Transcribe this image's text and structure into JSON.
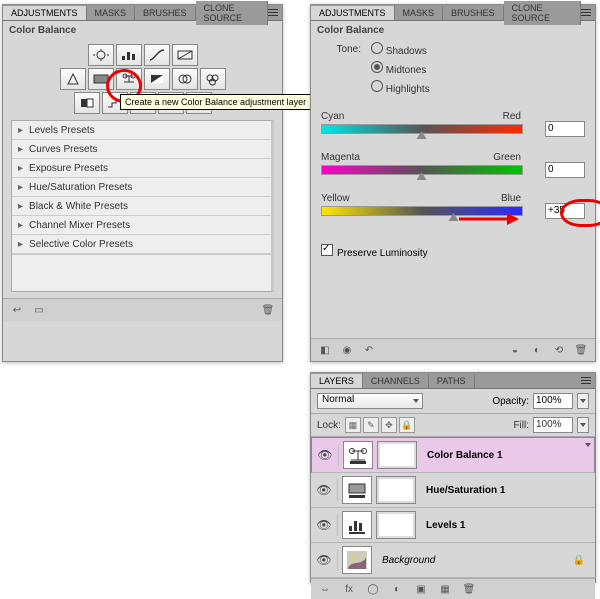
{
  "left": {
    "tabs": [
      "ADJUSTMENTS",
      "MASKS",
      "BRUSHES",
      "CLONE SOURCE"
    ],
    "title": "Color Balance",
    "tooltip": "Create a new Color Balance adjustment layer",
    "iconRows": [
      [
        "brightness-contrast-icon",
        "levels-icon",
        "curves-icon",
        "exposure-icon"
      ],
      [
        "vibrance-icon",
        "hue-saturation-icon",
        "color-balance-icon",
        "black-white-icon",
        "photo-filter-icon",
        "channel-mixer-icon"
      ],
      [
        "invert-icon",
        "posterize-icon",
        "threshold-icon",
        "gradient-map-icon",
        "selective-color-icon"
      ]
    ],
    "presets": [
      "Levels Presets",
      "Curves Presets",
      "Exposure Presets",
      "Hue/Saturation Presets",
      "Black & White Presets",
      "Channel Mixer Presets",
      "Selective Color Presets"
    ]
  },
  "right": {
    "tabs": [
      "ADJUSTMENTS",
      "MASKS",
      "BRUSHES",
      "CLONE SOURCE"
    ],
    "title": "Color Balance",
    "tone_label": "Tone:",
    "tone": [
      "Shadows",
      "Midtones",
      "Highlights"
    ],
    "tone_selected": 1,
    "sliders": [
      {
        "left": "Cyan",
        "right": "Red",
        "value": 0,
        "pos": 50,
        "grad": [
          "#00e5e5",
          "#555",
          "#ff2a00"
        ]
      },
      {
        "left": "Magenta",
        "right": "Green",
        "value": 0,
        "pos": 50,
        "grad": [
          "#ff00c8",
          "#555",
          "#00c400"
        ]
      },
      {
        "left": "Yellow",
        "right": "Blue",
        "value": "+35",
        "pos": 66,
        "grad": [
          "#ffe600",
          "#555",
          "#2a2aff"
        ]
      }
    ],
    "preserve": "Preserve Luminosity",
    "preserve_checked": true
  },
  "layers": {
    "tabs": [
      "LAYERS",
      "CHANNELS",
      "PATHS"
    ],
    "blend": "Normal",
    "opacity_label": "Opacity:",
    "opacity": "100%",
    "lock_label": "Lock:",
    "fill_label": "Fill:",
    "fill": "100%",
    "items": [
      {
        "name": "Color Balance 1",
        "kind": "color-balance",
        "mask": true,
        "selected": true
      },
      {
        "name": "Hue/Saturation 1",
        "kind": "hue-saturation",
        "mask": true,
        "selected": false
      },
      {
        "name": "Levels 1",
        "kind": "levels",
        "mask": true,
        "selected": false
      },
      {
        "name": "Background",
        "kind": "image",
        "mask": false,
        "selected": false,
        "locked": true,
        "italic": true
      }
    ]
  }
}
